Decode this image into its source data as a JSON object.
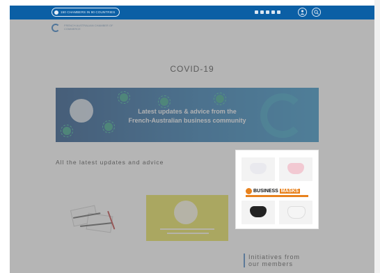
{
  "topbar": {
    "countries_label": "150 CHAMBERS IN 90 COUNTRIES",
    "social_icons": [
      "linkedin-icon",
      "instagram-icon",
      "facebook-icon",
      "twitter-icon",
      "youtube-icon"
    ],
    "accent": "#0b5fa5"
  },
  "header": {
    "logo_text": "FRENCH AUSTRALIAN CHAMBER OF COMMERCE"
  },
  "page": {
    "title": "COVID-19",
    "banner_text_line1": "Latest updates & advice from the",
    "banner_text_line2": "French-Australian business community",
    "subheading": "All the latest updates and advice"
  },
  "ad": {
    "brand_word1": "BUSINESS",
    "brand_word2": "MASKS"
  },
  "initiatives": {
    "line1": "Initiatives from",
    "line2": "our members"
  }
}
